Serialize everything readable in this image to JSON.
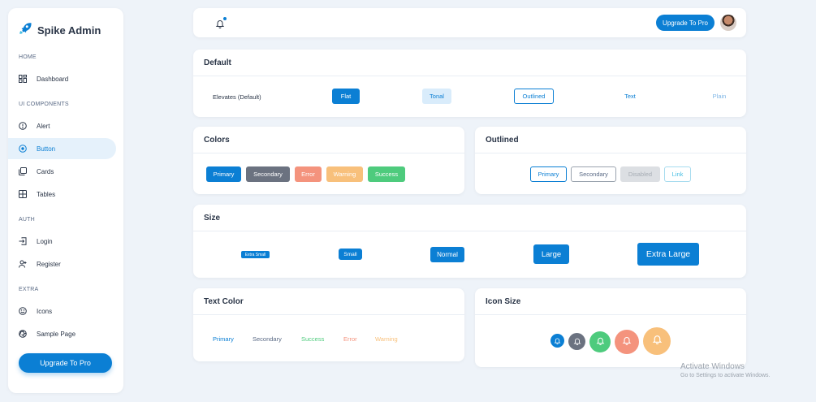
{
  "sidebar": {
    "app_name": "Spike Admin",
    "sections": {
      "home": "HOME",
      "ui": "UI COMPONENTS",
      "auth": "AUTH",
      "extra": "EXTRA"
    },
    "items": {
      "dashboard": "Dashboard",
      "alert": "Alert",
      "button": "Button",
      "cards": "Cards",
      "tables": "Tables",
      "login": "Login",
      "register": "Register",
      "icons": "Icons",
      "sample_page": "Sample Page"
    },
    "upgrade_label": "Upgrade To Pro"
  },
  "topbar": {
    "upgrade_label": "Upgrade To Pro"
  },
  "default_card": {
    "title": "Default",
    "label": "Elevates (Default)",
    "flat": "Flat",
    "tonal": "Tonal",
    "outlined": "Outlined",
    "text": "Text",
    "plain": "Plain"
  },
  "colors_card": {
    "title": "Colors",
    "primary": "Primary",
    "secondary": "Secondary",
    "error": "Error",
    "warning": "Warning",
    "success": "Success"
  },
  "outlined_card": {
    "title": "Outlined",
    "primary": "Primary",
    "secondary": "Secondary",
    "disabled": "Disabled",
    "link": "Link"
  },
  "size_card": {
    "title": "Size",
    "extra_small": "Extra Small",
    "small": "Small",
    "normal": "Normal",
    "large": "Large",
    "extra_large": "Extra Large"
  },
  "text_color_card": {
    "title": "Text Color",
    "primary": "Primary",
    "secondary": "Secondary",
    "success": "Success",
    "error": "Error",
    "warning": "Warning"
  },
  "icon_size_card": {
    "title": "Icon Size",
    "icons": [
      "bell-icon",
      "bell-icon",
      "bell-icon",
      "bell-icon",
      "bell-icon"
    ]
  },
  "watermark": {
    "line1": "Activate Windows",
    "line2": "Go to Settings to activate Windows."
  },
  "colors": {
    "primary": "#0b7fd4",
    "secondary": "#6b7280",
    "error": "#f4937d",
    "warning": "#f8c07b",
    "success": "#4ecb7d",
    "background": "#eef3f9"
  }
}
